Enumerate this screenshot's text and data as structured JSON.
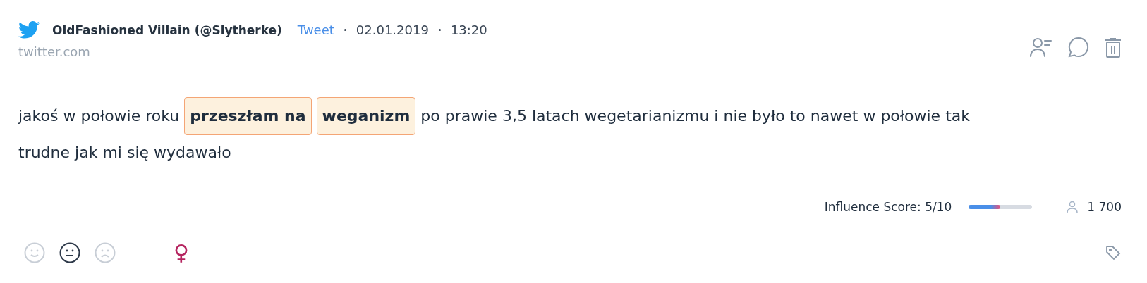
{
  "author": "OldFashioned Villain (@Slytherke)",
  "type_label": "Tweet",
  "date": "02.01.2019",
  "time": "13:20",
  "source": "twitter.com",
  "body_lines": [
    [
      {
        "text": "jakoś w połowie roku",
        "highlighted": false
      },
      {
        "text": "przeszłam na",
        "highlighted": true
      },
      {
        "text": "weganizm",
        "highlighted": true
      },
      {
        "text": "po prawie 3,5 latach wegetarianizmu i nie było to nawet w połowie tak",
        "highlighted": false
      }
    ],
    [
      {
        "text": "trudne jak mi się wydawało",
        "highlighted": false
      }
    ]
  ],
  "influence": {
    "label": "Influence Score: 5/10",
    "level": 0.5
  },
  "followers": "1 700",
  "sentiments": [
    {
      "kind": "positive",
      "selected": false
    },
    {
      "kind": "neutral",
      "selected": true
    },
    {
      "kind": "negative",
      "selected": false
    }
  ],
  "gender_symbol": "♀"
}
